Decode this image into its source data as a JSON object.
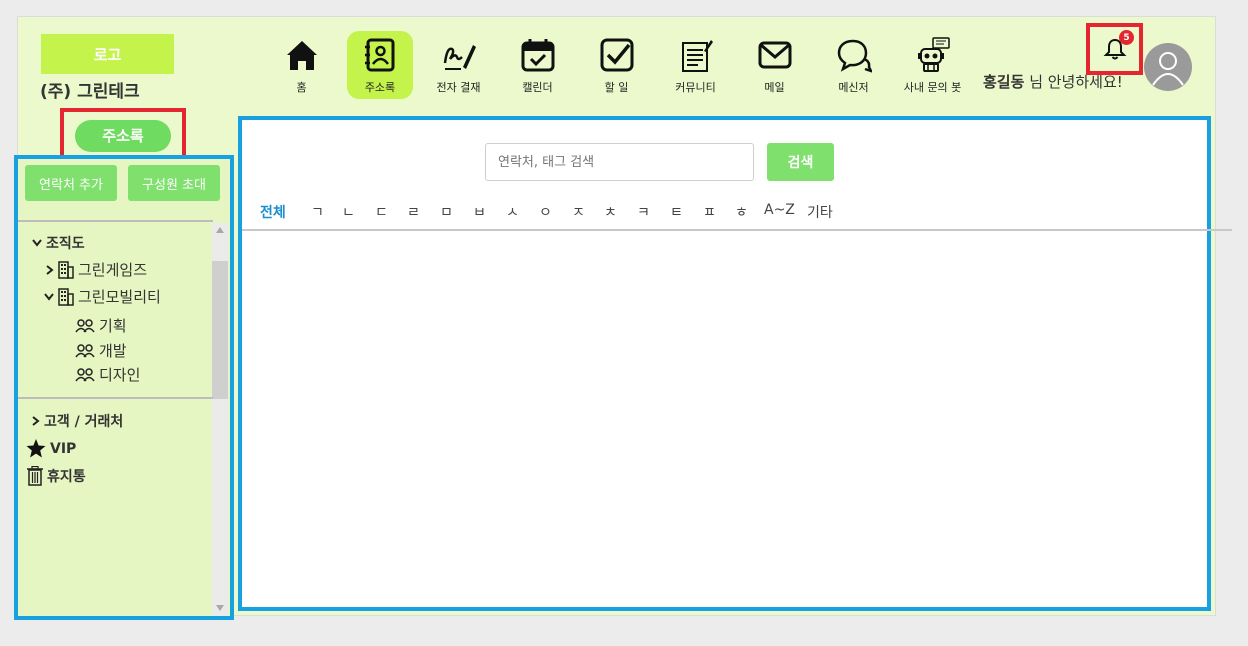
{
  "brand": {
    "logo": "로고",
    "company": "(주) 그린테크"
  },
  "nav": [
    {
      "icon": "home-icon",
      "label": "홈"
    },
    {
      "icon": "address-book-icon",
      "label": "주소록"
    },
    {
      "icon": "signature-icon",
      "label": "전자 결재"
    },
    {
      "icon": "calendar-icon",
      "label": "캘린더"
    },
    {
      "icon": "checkbox-icon",
      "label": "할 일"
    },
    {
      "icon": "community-icon",
      "label": "커뮤니티"
    },
    {
      "icon": "mail-icon",
      "label": "메일"
    },
    {
      "icon": "messenger-icon",
      "label": "메신저"
    },
    {
      "icon": "robot-icon",
      "label": "사내 문의 봇"
    }
  ],
  "user": {
    "name": "홍길동",
    "greeting_suffix": "님 안녕하세요!"
  },
  "notifications": {
    "count": "5"
  },
  "sidebar": {
    "title": "주소록",
    "add_contact": "연락처 추가",
    "invite_member": "구성원 초대",
    "tree": {
      "org_label": "조직도",
      "companies": [
        "그린게임즈",
        "그린모빌리티"
      ],
      "departments": [
        "기획",
        "개발",
        "디자인"
      ],
      "customers": "고객 / 거래처",
      "vip": "VIP",
      "trash": "휴지통"
    }
  },
  "main": {
    "search_placeholder": "연락처, 태그 검색",
    "search_button": "검색",
    "index_tabs": [
      "전체",
      "ㄱ",
      "ㄴ",
      "ㄷ",
      "ㄹ",
      "ㅁ",
      "ㅂ",
      "ㅅ",
      "ㅇ",
      "ㅈ",
      "ㅊ",
      "ㅋ",
      "ㅌ",
      "ㅍ",
      "ㅎ",
      "A~Z",
      "기타"
    ]
  },
  "colors": {
    "header_bg": "#ecf9cc",
    "accent_lime": "#c4f34b",
    "button_green": "#7fe06d",
    "highlight_red": "#e3262f",
    "highlight_blue": "#17a1e0",
    "index_active": "#1a8ecf"
  }
}
